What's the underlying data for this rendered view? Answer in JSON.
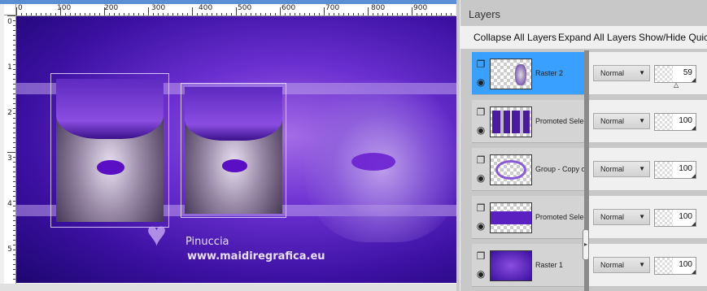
{
  "canvas": {
    "watermark_line1": "Pinuccia",
    "watermark_line2": "www.maidiregrafica.eu",
    "heart_glyph": "♥"
  },
  "ruler": {
    "h_labels": [
      "0",
      "100",
      "200",
      "300",
      "400",
      "500",
      "600",
      "700",
      "800",
      "900"
    ],
    "v_labels": [
      "0",
      "1",
      "2",
      "3",
      "4",
      "5"
    ]
  },
  "panel": {
    "title": "Layers",
    "toolbar": {
      "collapse_all": "Collapse All Layers",
      "expand_all": "Expand All Layers",
      "show_hide": "Show/Hide Quic"
    },
    "layers": [
      {
        "name": "Raster 2",
        "blend": "Normal",
        "opacity": "59",
        "selected": true,
        "thumb": "face"
      },
      {
        "name": "Promoted Selec",
        "blend": "Normal",
        "opacity": "100",
        "selected": false,
        "thumb": "pair"
      },
      {
        "name": "Group - Copy of",
        "blend": "Normal",
        "opacity": "100",
        "selected": false,
        "thumb": "ring"
      },
      {
        "name": "Promoted Selec",
        "blend": "Normal",
        "opacity": "100",
        "selected": false,
        "thumb": "strip"
      },
      {
        "name": "Raster 1",
        "blend": "Normal",
        "opacity": "100",
        "selected": false,
        "thumb": "purple"
      }
    ],
    "icons": {
      "layer_type": "layer-stack-icon",
      "visibility": "eye-icon",
      "dropdown": "dropdown-arrow-icon"
    },
    "colors": {
      "selected_row": "#3aa0ff",
      "canvas_purple": "#6a2fd0"
    }
  }
}
